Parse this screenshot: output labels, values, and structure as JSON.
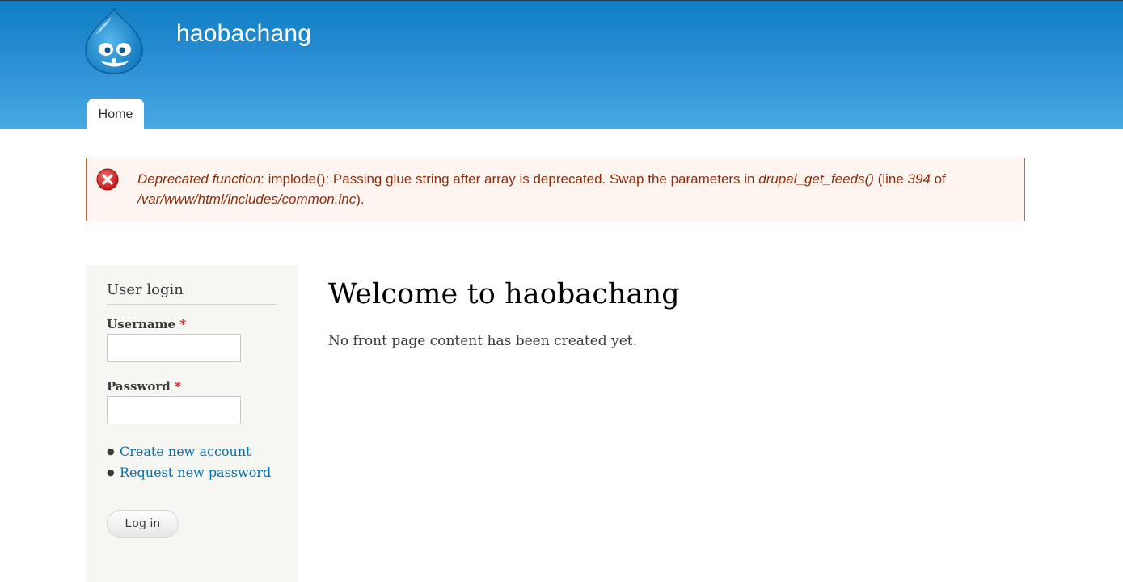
{
  "header": {
    "site_name": "haobachang",
    "menu": {
      "tabs": [
        {
          "label": "Home"
        }
      ]
    }
  },
  "messages": {
    "error": {
      "icon": "error-x-icon",
      "type_label": "Deprecated function",
      "text_1": ": implode(): Passing glue string after array is deprecated. Swap the parameters in ",
      "function_name": "drupal_get_feeds()",
      "text_2": " (line ",
      "line_number": "394",
      "text_3": " of ",
      "file_path": "/var/www/html/includes/common.inc",
      "text_4": ")."
    }
  },
  "sidebar": {
    "login_block": {
      "title": "User login",
      "username_label": "Username",
      "password_label": "Password",
      "required_marker": "*",
      "username_value": "",
      "password_value": "",
      "links": [
        {
          "label": "Create new account"
        },
        {
          "label": "Request new password"
        }
      ],
      "submit_label": "Log in"
    }
  },
  "main": {
    "title": "Welcome to haobachang",
    "body": "No front page content has been created yet."
  },
  "colors": {
    "header_top": "#0f7ec4",
    "header_bottom": "#48a9e3",
    "error_text": "#8c2e0b",
    "error_border": "#c66a3d",
    "error_background": "#fef5f1",
    "link": "#0071b3",
    "sidebar_background": "#f6f6f2"
  }
}
